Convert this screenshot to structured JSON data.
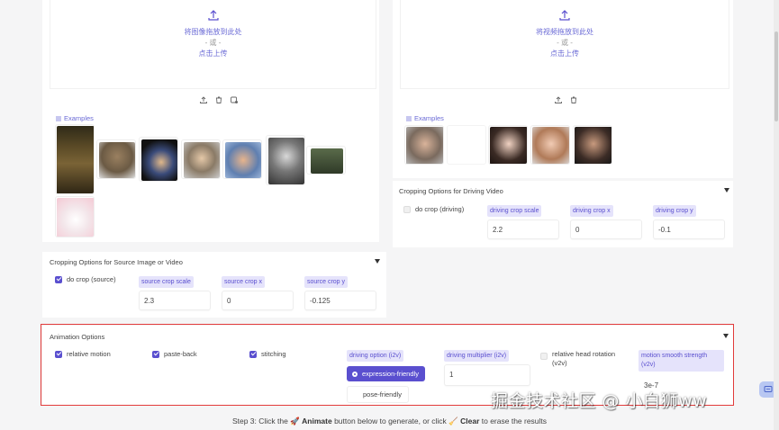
{
  "source_upload": {
    "drop_text": "将图像拖放到此处",
    "or_text": "- 或 -",
    "click_text": "点击上传"
  },
  "driving_upload": {
    "drop_text": "将视频拖放到此处",
    "or_text": "- 或 -",
    "click_text": "点击上传"
  },
  "source_examples": {
    "label": "Examples"
  },
  "driving_examples": {
    "label": "Examples"
  },
  "driving_crop": {
    "title": "Cropping Options for Driving Video",
    "do_crop_label": "do crop (driving)",
    "scale_label": "driving crop scale",
    "scale_value": "2.2",
    "x_label": "driving crop x",
    "x_value": "0",
    "y_label": "driving crop y",
    "y_value": "-0.1"
  },
  "source_crop": {
    "title": "Cropping Options for Source Image or Video",
    "do_crop_label": "do crop (source)",
    "scale_label": "source crop scale",
    "scale_value": "2.3",
    "x_label": "source crop x",
    "x_value": "0",
    "y_label": "source crop y",
    "y_value": "-0.125"
  },
  "animation": {
    "title": "Animation Options",
    "relative_motion": "relative motion",
    "paste_back": "paste-back",
    "stitching": "stitching",
    "driving_option_label": "driving option (i2v)",
    "option_selected": "expression-friendly",
    "option_other": "pose-friendly",
    "multiplier_label": "driving multiplier (i2v)",
    "multiplier_value": "1",
    "head_rotation_label": "relative head rotation (v2v)",
    "smooth_label": "motion smooth strength (v2v)",
    "smooth_value": "3e-7"
  },
  "watermark": "掘金技术社区 @ 小白狮ww",
  "step3": {
    "prefix": "Step 3: Click the 🚀 ",
    "animate": "Animate",
    "middle": " button below to generate, or click 🧹 ",
    "clear": "Clear",
    "suffix": " to erase the results"
  },
  "colors": {
    "accent": "#5a4fcf",
    "highlight_border": "#e23b3b",
    "link": "#6b6bd6"
  }
}
